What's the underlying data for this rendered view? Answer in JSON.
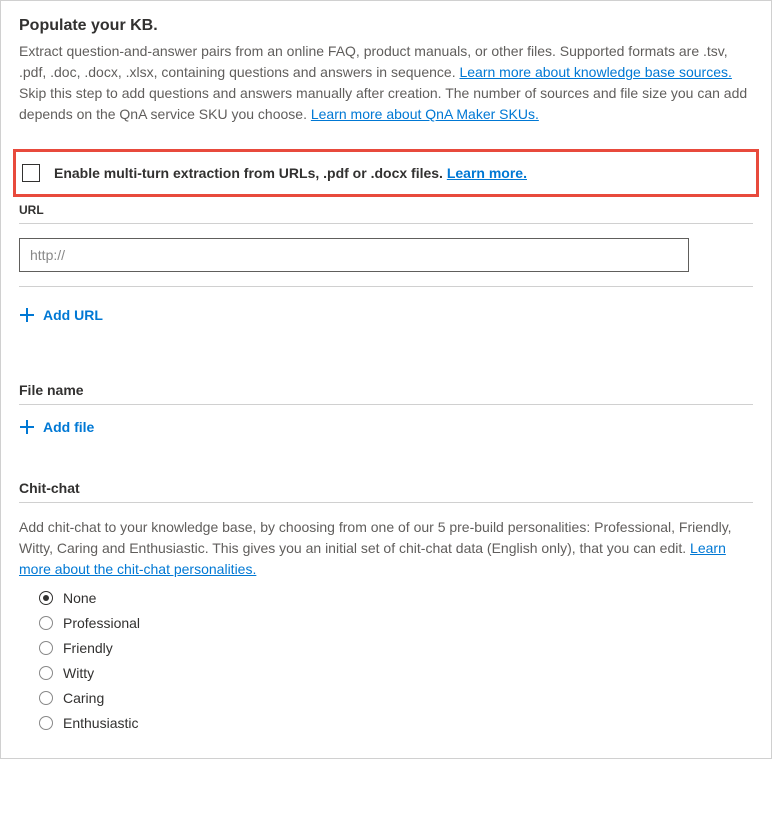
{
  "heading": "Populate your KB.",
  "description": {
    "part1": "Extract question-and-answer pairs from an online FAQ, product manuals, or other files. Supported formats are .tsv, .pdf, .doc, .docx, .xlsx, containing questions and answers in sequence. ",
    "link1": "Learn more about knowledge base sources. ",
    "part2": "Skip this step to add questions and answers manually after creation. The number of sources and file size you can add depends on the QnA service SKU you choose. ",
    "link2": "Learn more about QnA Maker SKUs."
  },
  "enable": {
    "text": "Enable multi-turn extraction from URLs, .pdf or .docx files. ",
    "link": "Learn more."
  },
  "url_section": {
    "label": "URL",
    "placeholder": "http://",
    "add_label": "Add URL"
  },
  "file_section": {
    "label": "File name",
    "add_label": "Add file"
  },
  "chitchat": {
    "heading": "Chit-chat",
    "desc_part1": "Add chit-chat to your knowledge base, by choosing from one of our 5 pre-build personalities: Professional, Friendly, Witty, Caring and Enthusiastic. This gives you an initial set of chit-chat data (English only), that you can edit. ",
    "desc_link": "Learn more about the chit-chat personalities.",
    "options": [
      {
        "label": "None",
        "selected": true
      },
      {
        "label": "Professional",
        "selected": false
      },
      {
        "label": "Friendly",
        "selected": false
      },
      {
        "label": "Witty",
        "selected": false
      },
      {
        "label": "Caring",
        "selected": false
      },
      {
        "label": "Enthusiastic",
        "selected": false
      }
    ]
  }
}
